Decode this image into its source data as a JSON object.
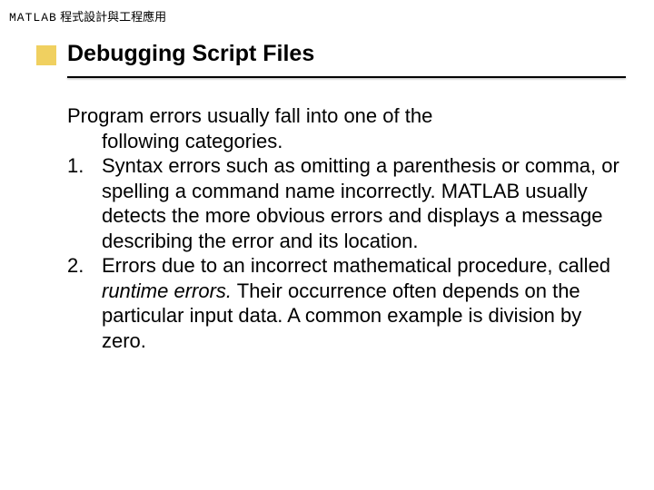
{
  "header": {
    "matlab": "MATLAB",
    "chinese": " 程式設計與工程應用"
  },
  "title": "Debugging Script Files",
  "content": {
    "intro_line1": "Program errors usually fall into one of the",
    "intro_line2": "following categories.",
    "item1": {
      "num": "1.",
      "text": "Syntax errors such as omitting a parenthesis or comma, or spelling a command name incorrectly. MATLAB usually detects the more obvious errors and displays a message describing the error and its location."
    },
    "item2": {
      "num": "2.",
      "text_before": "Errors due to an incorrect mathematical procedure, called ",
      "text_italic": "runtime errors.",
      "text_after": " Their occurrence often depends on the particular input data. A common example is division by zero."
    }
  }
}
